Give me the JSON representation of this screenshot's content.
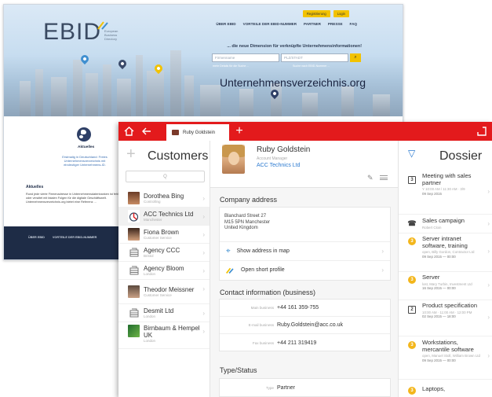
{
  "web": {
    "logo": "EBID",
    "logo_sub": "European Business Directory",
    "auth": [
      "Registrierung",
      "Login"
    ],
    "nav": [
      "ÜBER EBID",
      "VORTEILE DER EBID-NUMMER",
      "PARTNER",
      "PRESSE",
      "FAQ"
    ],
    "tagline": "... die neue Dimension für verknüpfte Unternehmensinformationen!",
    "search_name_placeholder": "Firmenname",
    "search_zip_placeholder": "PLZ/STADT",
    "hint_left": "mehr Details für die Suche ...",
    "hint_right": "Suche nach EBID-Nummer ...",
    "domain": "Unternehmensverzeichnis.org",
    "aktuelles_1": "Aktuelles",
    "text_1": "Erstmalig in Deutschland: Freies Unternehmensverzeichnis mit eindeutiger Unternehmens-ID.",
    "aktuelles_2": "Aktuelles",
    "text_2": "Rund jede vierte Firmenadresse in Unternehmensdatenbanken ist fehlerhaft oder veraltet mit fatalen Folgen für die digitale Geschäftswelt. Unternehmensverzeichnis.org bietet eine Referenz ...",
    "footer_links": [
      "ÜBER EBID",
      "VORTEILE DER EBID-NUMMER"
    ]
  },
  "app": {
    "tab_label": "Ruby Goldstein",
    "customers": {
      "title": "Customers",
      "search_placeholder": "Q",
      "items": [
        {
          "name": "Dorothea Bing",
          "sub": "Controlling"
        },
        {
          "name": "ACC Technics Ltd",
          "sub": "Manchester"
        },
        {
          "name": "Fiona Brown",
          "sub": "Customer Service"
        },
        {
          "name": "Agency CCC",
          "sub": "Bristol"
        },
        {
          "name": "Agency Bloom",
          "sub": "London"
        },
        {
          "name": "Theodor Meissner",
          "sub": "Customer Service"
        },
        {
          "name": "Desmit Ltd",
          "sub": "London"
        },
        {
          "name": "Birnbaum & Hempel UK",
          "sub": "London"
        }
      ]
    },
    "detail": {
      "name": "Ruby Goldstein",
      "role": "Account Manager",
      "company": "ACC Technics Ltd",
      "company_address_title": "Company address",
      "address": [
        "Blanchard Street 27",
        "M15 5PN Manchester",
        "United Kingdom"
      ],
      "show_map": "Show address in map",
      "open_profile": "Open short profile",
      "contact_title": "Contact information (business)",
      "contacts": [
        {
          "key": "Main business",
          "value": "+44 161 359-755"
        },
        {
          "key": "E-mail business",
          "value": "Ruby.Goldstein@acc.co.uk"
        },
        {
          "key": "Fax business",
          "value": "+44 211 319419"
        }
      ],
      "type_title": "Type/Status",
      "type_key": "Type",
      "type_value": "Partner"
    },
    "dossier": {
      "title": "Dossier",
      "items": [
        {
          "icon": "doc",
          "glyph": "3",
          "title": "Meeting with sales partner",
          "meta": "Y 10:00 AM / 11:30 AM · 3/9",
          "date": "09 Sep 2015"
        },
        {
          "icon": "phone",
          "glyph": "☎",
          "title": "Sales campaign",
          "meta": "Robert Cloin",
          "date": ""
        },
        {
          "icon": "coin",
          "glyph": "3",
          "title": "Server intranet software, training",
          "meta": "open, Billy Gordon, Contractor Ltd",
          "date": "09 Sep 2015 — 00:00"
        },
        {
          "icon": "coin",
          "glyph": "3",
          "title": "Server",
          "meta": "lost, Mary Turbin, Investment Ltd",
          "date": "16 Sep 2015 — 00:00"
        },
        {
          "icon": "doc",
          "glyph": "2",
          "title": "Product specification",
          "meta": "10:00 AM · 11:00 AM · 12:00 PM",
          "date": "02 Sep 2015 — 18:00"
        },
        {
          "icon": "coin",
          "glyph": "3",
          "title": "Workstations, mercantile software",
          "meta": "open, Manuel Stoll, William Brown Ltd",
          "date": "09 Sep 2015 — 00:00"
        },
        {
          "icon": "coin",
          "glyph": "3",
          "title": "Laptops,",
          "meta": "",
          "date": ""
        }
      ]
    }
  }
}
